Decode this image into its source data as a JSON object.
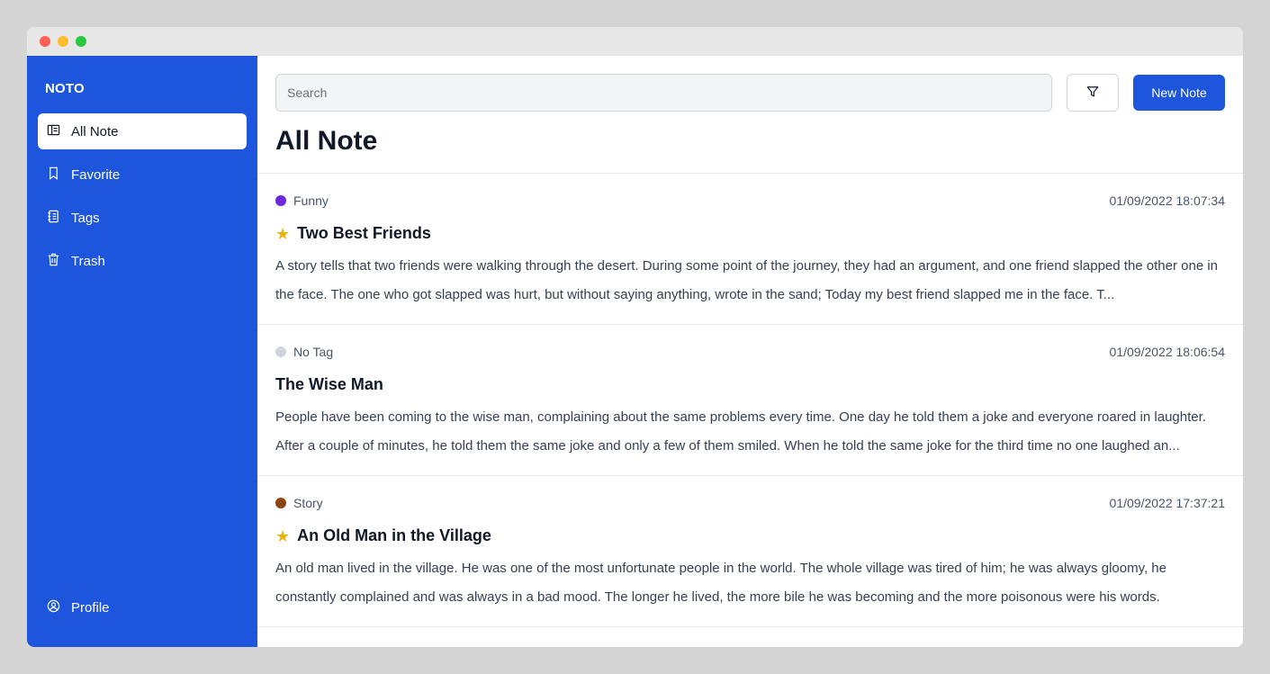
{
  "window": {
    "controls": [
      "close",
      "minimize",
      "maximize"
    ],
    "colors": {
      "close": "#ff5f57",
      "minimize": "#febc2e",
      "maximize": "#28c840"
    }
  },
  "sidebar": {
    "brand": "NOTO",
    "accent": "#1d55dc",
    "items": [
      {
        "label": "All Note",
        "icon": "note-list-icon",
        "active": true
      },
      {
        "label": "Favorite",
        "icon": "bookmark-icon",
        "active": false
      },
      {
        "label": "Tags",
        "icon": "tags-icon",
        "active": false
      },
      {
        "label": "Trash",
        "icon": "trash-icon",
        "active": false
      }
    ],
    "profile": {
      "label": "Profile",
      "icon": "user-circle-icon"
    }
  },
  "toolbar": {
    "search_placeholder": "Search",
    "search_value": "",
    "filter_icon": "filter-icon",
    "new_note_label": "New Note"
  },
  "page": {
    "title": "All Note"
  },
  "notes": [
    {
      "tag": "Funny",
      "tag_color": "#6d28d9",
      "timestamp": "01/09/2022 18:07:34",
      "favorite": true,
      "title": "Two Best Friends",
      "body": "A story tells that two friends were walking through the desert. During some point of the journey, they had an argument, and one friend slapped the other one in the face. The one who got slapped was hurt, but without saying anything, wrote in the sand; Today my best friend slapped me in the face. T..."
    },
    {
      "tag": "No Tag",
      "tag_color": "#d1d5db",
      "timestamp": "01/09/2022 18:06:54",
      "favorite": false,
      "title": "The Wise Man",
      "body": "People have been coming to the wise man, complaining about the same problems every time. One day he told them a joke and everyone roared in laughter. After a couple of minutes, he told them the same joke and only a few of them smiled. When he told the same joke for the third time no one laughed an..."
    },
    {
      "tag": "Story",
      "tag_color": "#8b4513",
      "timestamp": "01/09/2022 17:37:21",
      "favorite": true,
      "title": "An Old Man in the Village",
      "body": "An old man lived in the village. He was one of the most unfortunate people in the world. The whole village was tired of him; he was always gloomy, he constantly complained and was always in a bad mood. The longer he lived, the more bile he was becoming and the more poisonous were his words."
    }
  ]
}
